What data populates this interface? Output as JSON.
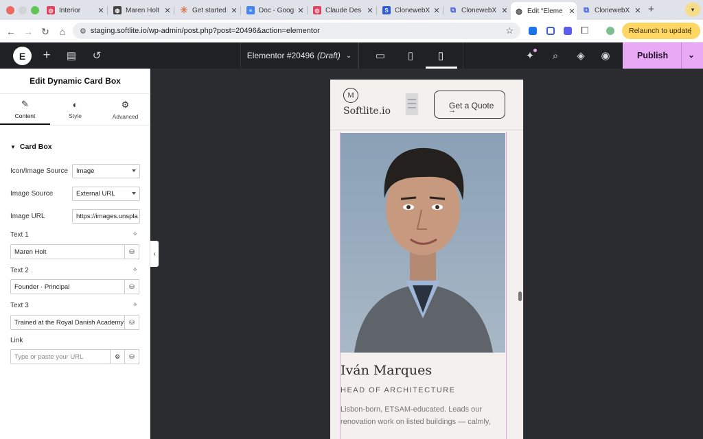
{
  "browser": {
    "tabs": [
      {
        "label": "Interior"
      },
      {
        "label": "Maren Holt"
      },
      {
        "label": "Get started"
      },
      {
        "label": "Doc - Goog"
      },
      {
        "label": "Claude Des"
      },
      {
        "label": "ClonewebX"
      },
      {
        "label": "ClonewebX"
      },
      {
        "label": "Edit “Eleme"
      },
      {
        "label": "ClonewebX"
      }
    ],
    "url": "staging.softlite.io/wp-admin/post.php?post=20496&action=elementor",
    "relaunch_label": "Relaunch to update",
    "colors": {
      "tabstrip": "#dfe2e8",
      "relaunch_bg": "#fdd663"
    }
  },
  "editor": {
    "logo": "E",
    "document_title": "Elementor #20496",
    "document_status": "(Draft)",
    "publish_label": "Publish",
    "colors": {
      "topbar": "#1f2124",
      "publish_bg": "#e8a9f5",
      "canvas_bg": "#2b2c30"
    }
  },
  "panel": {
    "title": "Edit Dynamic Card Box",
    "tabs": [
      {
        "label": "Content",
        "icon": "pencil-icon"
      },
      {
        "label": "Style",
        "icon": "half-circle-icon"
      },
      {
        "label": "Advanced",
        "icon": "gear-icon"
      }
    ],
    "section_title": "Card Box",
    "fields": {
      "icon_image_source": {
        "label": "Icon/Image Source",
        "value": "Image"
      },
      "image_source": {
        "label": "Image Source",
        "value": "External URL"
      },
      "image_url": {
        "label": "Image URL",
        "value": "https://images.unspla"
      },
      "text1": {
        "label": "Text 1",
        "value": "Maren Holt"
      },
      "text2": {
        "label": "Text 2",
        "value": "Founder · Principal"
      },
      "text3": {
        "label": "Text 3",
        "value": "Trained at the Royal Danish Academy"
      },
      "link": {
        "label": "Link",
        "placeholder": "Type or paste your URL"
      }
    }
  },
  "preview": {
    "logo_initial": "M",
    "brand_name": "Softlite.io",
    "cta_label": "Get a Quote",
    "cta_arrow": "→",
    "card": {
      "name": "Iván Marques",
      "role": "HEAD OF ARCHITECTURE",
      "bio": "Lisbon-born, ETSAM-educated. Leads our renovation work on listed buildings — calmly,"
    }
  }
}
